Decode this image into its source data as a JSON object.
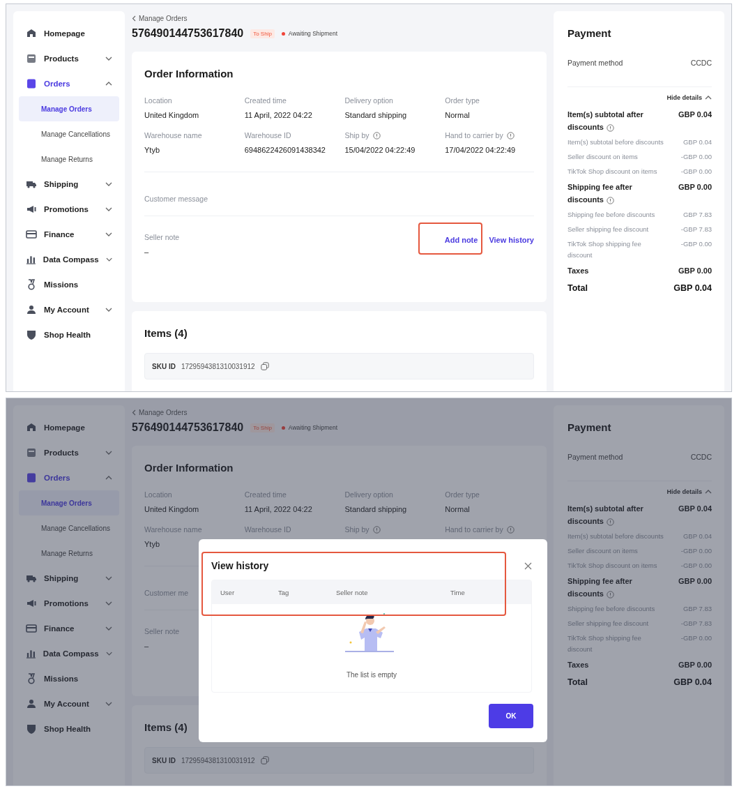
{
  "screens": [
    {
      "breadcrumb": "Manage Orders",
      "order_number": "576490144753617840",
      "tag": "To Ship",
      "status": "Awaiting Shipment",
      "sidebar": {
        "items": [
          {
            "kind": "link",
            "label": "Homepage",
            "selected": false
          },
          {
            "kind": "group",
            "label": "Products",
            "selected": false,
            "expanded": false
          },
          {
            "kind": "group",
            "label": "Orders",
            "selected": true,
            "expanded": true,
            "children": [
              {
                "label": "Manage Orders",
                "selected": true
              },
              {
                "label": "Manage Cancellations",
                "selected": false
              },
              {
                "label": "Manage Returns",
                "selected": false
              }
            ]
          },
          {
            "kind": "group",
            "label": "Shipping",
            "selected": false,
            "expanded": false
          },
          {
            "kind": "group",
            "label": "Promotions",
            "selected": false,
            "expanded": false
          },
          {
            "kind": "group",
            "label": "Finance",
            "selected": false,
            "expanded": false
          },
          {
            "kind": "group",
            "label": "Data Compass",
            "selected": false,
            "expanded": false
          },
          {
            "kind": "link",
            "label": "Missions",
            "selected": false
          },
          {
            "kind": "group",
            "label": "My Account",
            "selected": false,
            "expanded": false
          },
          {
            "kind": "link",
            "label": "Shop Health",
            "selected": false
          }
        ]
      },
      "order_info": {
        "title": "Order Information",
        "fields": [
          {
            "label": "Location",
            "value": "United Kingdom",
            "info": false
          },
          {
            "label": "Created time",
            "value": "11 April, 2022 04:22",
            "info": false
          },
          {
            "label": "Delivery option",
            "value": "Standard shipping",
            "info": false
          },
          {
            "label": "Order type",
            "value": "Normal",
            "info": false
          },
          {
            "label": "Warehouse name",
            "value": "Ytyb",
            "info": false
          },
          {
            "label": "Warehouse ID",
            "value": "6948622426091438342",
            "info": false
          },
          {
            "label": "Ship by",
            "value": "15/04/2022 04:22:49",
            "info": true
          },
          {
            "label": "Hand to carrier by",
            "value": "17/04/2022 04:22:49",
            "info": true
          }
        ],
        "customer_message": "Customer message",
        "seller_note": {
          "label": "Seller note",
          "value": "–",
          "actions": [
            {
              "label": "Add note",
              "highlighted": true
            },
            {
              "label": "View history",
              "highlighted": false
            }
          ]
        }
      },
      "items": {
        "title": "Items (4)",
        "sku_label": "SKU ID",
        "sku_id": "1729594381310031912"
      },
      "payment": {
        "title": "Payment",
        "method_label": "Payment method",
        "method_value": "CCDC",
        "toggle": "Hide details",
        "rows": [
          {
            "kind": "major",
            "label": "Item(s) subtotal after discounts",
            "value": "GBP 0.04",
            "info": true
          },
          {
            "kind": "minor",
            "label": "Item(s) subtotal before discounts",
            "value": "GBP 0.04",
            "info": false
          },
          {
            "kind": "minor",
            "label": "Seller discount on items",
            "value": "-GBP 0.00",
            "info": false
          },
          {
            "kind": "minor",
            "label": "TikTok Shop discount on items",
            "value": "-GBP 0.00",
            "info": false
          },
          {
            "kind": "major",
            "label": "Shipping fee after discounts",
            "value": "GBP 0.00",
            "info": true
          },
          {
            "kind": "minor",
            "label": "Shipping fee before discounts",
            "value": "GBP 7.83",
            "info": false
          },
          {
            "kind": "minor",
            "label": "Seller shipping fee discount",
            "value": "-GBP 7.83",
            "info": false
          },
          {
            "kind": "minor",
            "label": "TikTok Shop shipping fee discount",
            "value": "-GBP 0.00",
            "info": false
          },
          {
            "kind": "major",
            "label": "Taxes",
            "value": "GBP 0.00",
            "info": false
          },
          {
            "kind": "total",
            "label": "Total",
            "value": "GBP 0.04",
            "info": false
          }
        ]
      }
    },
    {
      "breadcrumb": "Manage Orders",
      "order_number": "576490144753617840",
      "tag": "To Ship",
      "status": "Awaiting Shipment",
      "sidebar": {
        "items": [
          {
            "kind": "link",
            "label": "Homepage",
            "selected": false
          },
          {
            "kind": "group",
            "label": "Products",
            "selected": false,
            "expanded": false
          },
          {
            "kind": "group",
            "label": "Orders",
            "selected": true,
            "expanded": true,
            "children": [
              {
                "label": "Manage Orders",
                "selected": true
              },
              {
                "label": "Manage Cancellations",
                "selected": false
              },
              {
                "label": "Manage Returns",
                "selected": false
              }
            ]
          },
          {
            "kind": "group",
            "label": "Shipping",
            "selected": false,
            "expanded": false
          },
          {
            "kind": "group",
            "label": "Promotions",
            "selected": false,
            "expanded": false
          },
          {
            "kind": "group",
            "label": "Finance",
            "selected": false,
            "expanded": false
          },
          {
            "kind": "group",
            "label": "Data Compass",
            "selected": false,
            "expanded": false
          },
          {
            "kind": "link",
            "label": "Missions",
            "selected": false
          },
          {
            "kind": "group",
            "label": "My Account",
            "selected": false,
            "expanded": false
          },
          {
            "kind": "link",
            "label": "Shop Health",
            "selected": false
          }
        ]
      },
      "order_info": {
        "title": "Order Information",
        "fields": [
          {
            "label": "Location",
            "value": "United Kingdom",
            "info": false
          },
          {
            "label": "Created time",
            "value": "11 April, 2022 04:22",
            "info": false
          },
          {
            "label": "Delivery option",
            "value": "Standard shipping",
            "info": false
          },
          {
            "label": "Order type",
            "value": "Normal",
            "info": false
          },
          {
            "label": "Warehouse name",
            "value": "Ytyb",
            "info": false
          },
          {
            "label": "Warehouse ID",
            "info": false
          },
          {
            "label": "Ship by",
            "info": true
          },
          {
            "label": "Hand to carrier by",
            "info": true
          }
        ],
        "customer_message": "Customer me",
        "seller_note": {
          "label": "Seller note",
          "value": "–"
        }
      },
      "items": {
        "title": "Items (4)",
        "sku_label": "SKU ID",
        "sku_id": "1729594381310031912"
      },
      "payment": {
        "title": "Payment",
        "method_label": "Payment method",
        "method_value": "CCDC",
        "toggle": "Hide details",
        "rows": [
          {
            "kind": "major",
            "label": "Item(s) subtotal after discounts",
            "value": "GBP 0.04",
            "info": true
          },
          {
            "kind": "minor",
            "label": "Item(s) subtotal before discounts",
            "value": "GBP 0.04",
            "info": false
          },
          {
            "kind": "minor",
            "label": "Seller discount on items",
            "value": "-GBP 0.00",
            "info": false
          },
          {
            "kind": "minor",
            "label": "TikTok Shop discount on items",
            "value": "-GBP 0.00",
            "info": false
          },
          {
            "kind": "major",
            "label": "Shipping fee after discounts",
            "value": "GBP 0.00",
            "info": true
          },
          {
            "kind": "minor",
            "label": "Shipping fee before discounts",
            "value": "GBP 7.83",
            "info": false
          },
          {
            "kind": "minor",
            "label": "Seller shipping fee discount",
            "value": "-GBP 7.83",
            "info": false
          },
          {
            "kind": "minor",
            "label": "TikTok Shop shipping fee discount",
            "value": "-GBP 0.00",
            "info": false
          },
          {
            "kind": "major",
            "label": "Taxes",
            "value": "GBP 0.00",
            "info": false
          },
          {
            "kind": "total",
            "label": "Total",
            "value": "GBP 0.04",
            "info": false
          }
        ]
      },
      "modal": {
        "title": "View history",
        "highlighted": true,
        "columns": [
          "User",
          "Tag",
          "Seller note",
          "Time"
        ],
        "empty_text": "The list is empty",
        "ok": "OK"
      }
    }
  ]
}
